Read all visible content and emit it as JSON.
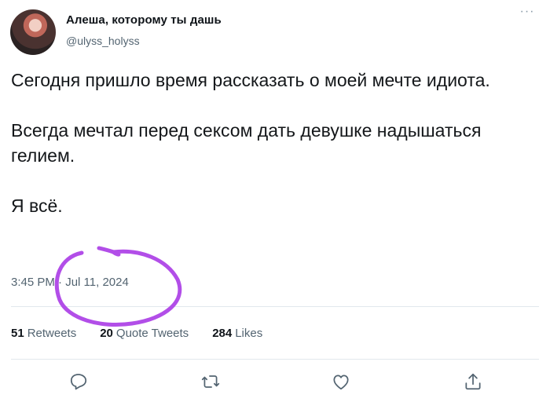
{
  "user": {
    "name": "Алеша, которому ты дашь",
    "handle": "@ulyss_holyss",
    "more_icon": "more-dots-icon"
  },
  "tweet": {
    "paragraphs": [
      "Сегодня пришло время рассказать о моей мечте идиота.",
      "Всегда мечтал перед сексом дать девушке надышаться гелием.",
      "Я всё."
    ],
    "time": "3:45 PM",
    "separator": "·",
    "date": "Jul 11, 2024"
  },
  "stats": {
    "retweets_count": "51",
    "retweets_label": "Retweets",
    "quotes_count": "20",
    "quotes_label": "Quote Tweets",
    "likes_count": "284",
    "likes_label": "Likes"
  },
  "actions": [
    {
      "icon": "reply-icon"
    },
    {
      "icon": "retweet-icon"
    },
    {
      "icon": "like-icon"
    },
    {
      "icon": "share-icon"
    }
  ],
  "colors": {
    "annotation_circle": "#b24ee8",
    "secondary_text": "#536471",
    "divider": "#e1e8ed"
  }
}
